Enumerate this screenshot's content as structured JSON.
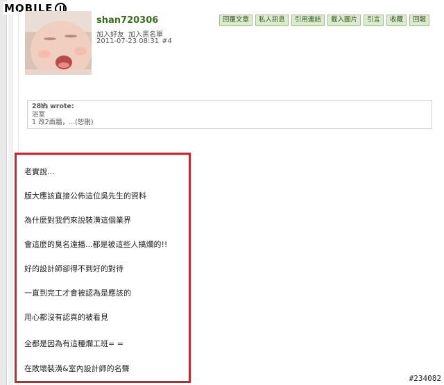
{
  "site": {
    "logo_text": "MOBILE"
  },
  "post": {
    "username": "shan720306",
    "user_links": [
      "加入好友",
      "加入黑名單"
    ],
    "timestamp": "2011-07-23 08:31",
    "post_number": "#4",
    "actions": [
      "回覆文章",
      "私人訊息",
      "引用連結",
      "載入圖片",
      "引言",
      "收藏",
      "回報"
    ],
    "quote": {
      "author_line": "28㍱ wrote:",
      "lines": [
        "浴室",
        "1 改2面牆，...(恕刪)"
      ]
    },
    "body_lines": [
      "老實說...",
      "版大應該直接公佈這位吳先生的資料",
      "為什麼對我們來說裝潢這個業界",
      "會這麼的臭名遠播...都是被這些人搞爛的!!",
      "好的設計師卻得不到好的對待",
      "一直到完工才會被認為是應該的",
      "用心都沒有認真的被看見",
      "全都是因為有這種爛工班= =",
      "在敗壞裝潢&室內設計師的名聲"
    ]
  },
  "watermark": "#234082",
  "colors": {
    "accent_green": "#3b6e1d",
    "button_bg": "#dcebd0",
    "highlight_red": "#c8262d"
  }
}
